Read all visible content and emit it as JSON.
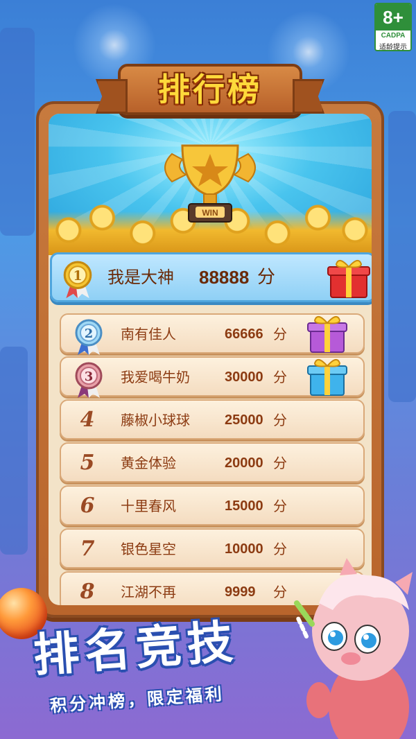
{
  "age_rating": {
    "label": "8+",
    "org": "CADPA",
    "tip": "适龄提示"
  },
  "title": "排行榜",
  "trophy_text": "WIN",
  "leaderboard": [
    {
      "rank": "1",
      "name": "我是大神",
      "score": "88888",
      "unit": "分",
      "medal": "gold-medal",
      "gift": "red-gift"
    },
    {
      "rank": "2",
      "name": "南有佳人",
      "score": "66666",
      "unit": "分",
      "medal": "silver-medal",
      "gift": "purple-gift"
    },
    {
      "rank": "3",
      "name": "我爱喝牛奶",
      "score": "30000",
      "unit": "分",
      "medal": "bronze-medal",
      "gift": "blue-gift"
    },
    {
      "rank": "4",
      "name": "藤椒小球球",
      "score": "25000",
      "unit": "分"
    },
    {
      "rank": "5",
      "name": "黄金体验",
      "score": "20000",
      "unit": "分"
    },
    {
      "rank": "6",
      "name": "十里春风",
      "score": "15000",
      "unit": "分"
    },
    {
      "rank": "7",
      "name": "银色星空",
      "score": "10000",
      "unit": "分"
    },
    {
      "rank": "8",
      "name": "江湖不再",
      "score": "9999",
      "unit": "分"
    }
  ],
  "slogan": "排名竞技",
  "subslogan": "积分冲榜，限定福利",
  "colors": {
    "board": "#b9652c",
    "row": "#f4dcc0",
    "first_row": "#8fd0f5",
    "text": "#8c3b12",
    "title": "#ffd93b"
  }
}
